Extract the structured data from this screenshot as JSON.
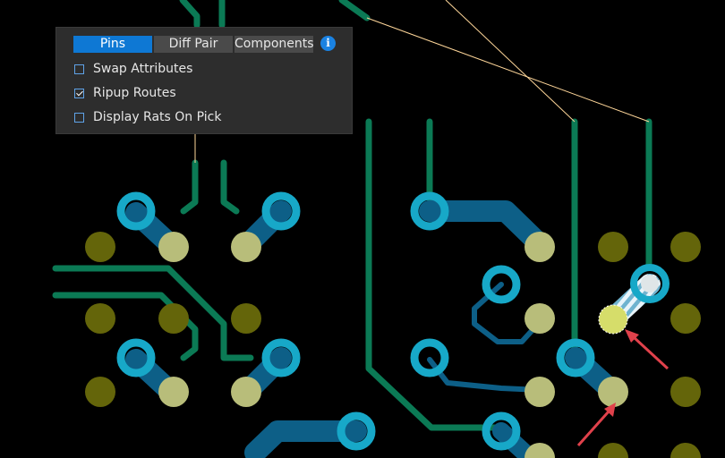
{
  "panel": {
    "tabs": [
      {
        "label": "Pins",
        "active": true
      },
      {
        "label": "Diff Pair",
        "active": false
      },
      {
        "label": "Components",
        "active": false
      }
    ],
    "info_icon": "info-icon",
    "options": [
      {
        "label": "Swap Attributes",
        "checked": false
      },
      {
        "label": "Ripup Routes",
        "checked": true
      },
      {
        "label": "Display Rats On Pick",
        "checked": false
      }
    ]
  },
  "colors": {
    "trace_green": "#0b7a55",
    "trace_blue": "#0d5f87",
    "via_ring": "#17a8c8",
    "pad_yellow": "#64650a",
    "pad_light": "#c6c98a",
    "rat_line": "#ffd79a",
    "arrow_red": "#e0414b",
    "panel_bg": "#2d2d2d",
    "tab_active": "#0e78d4"
  }
}
